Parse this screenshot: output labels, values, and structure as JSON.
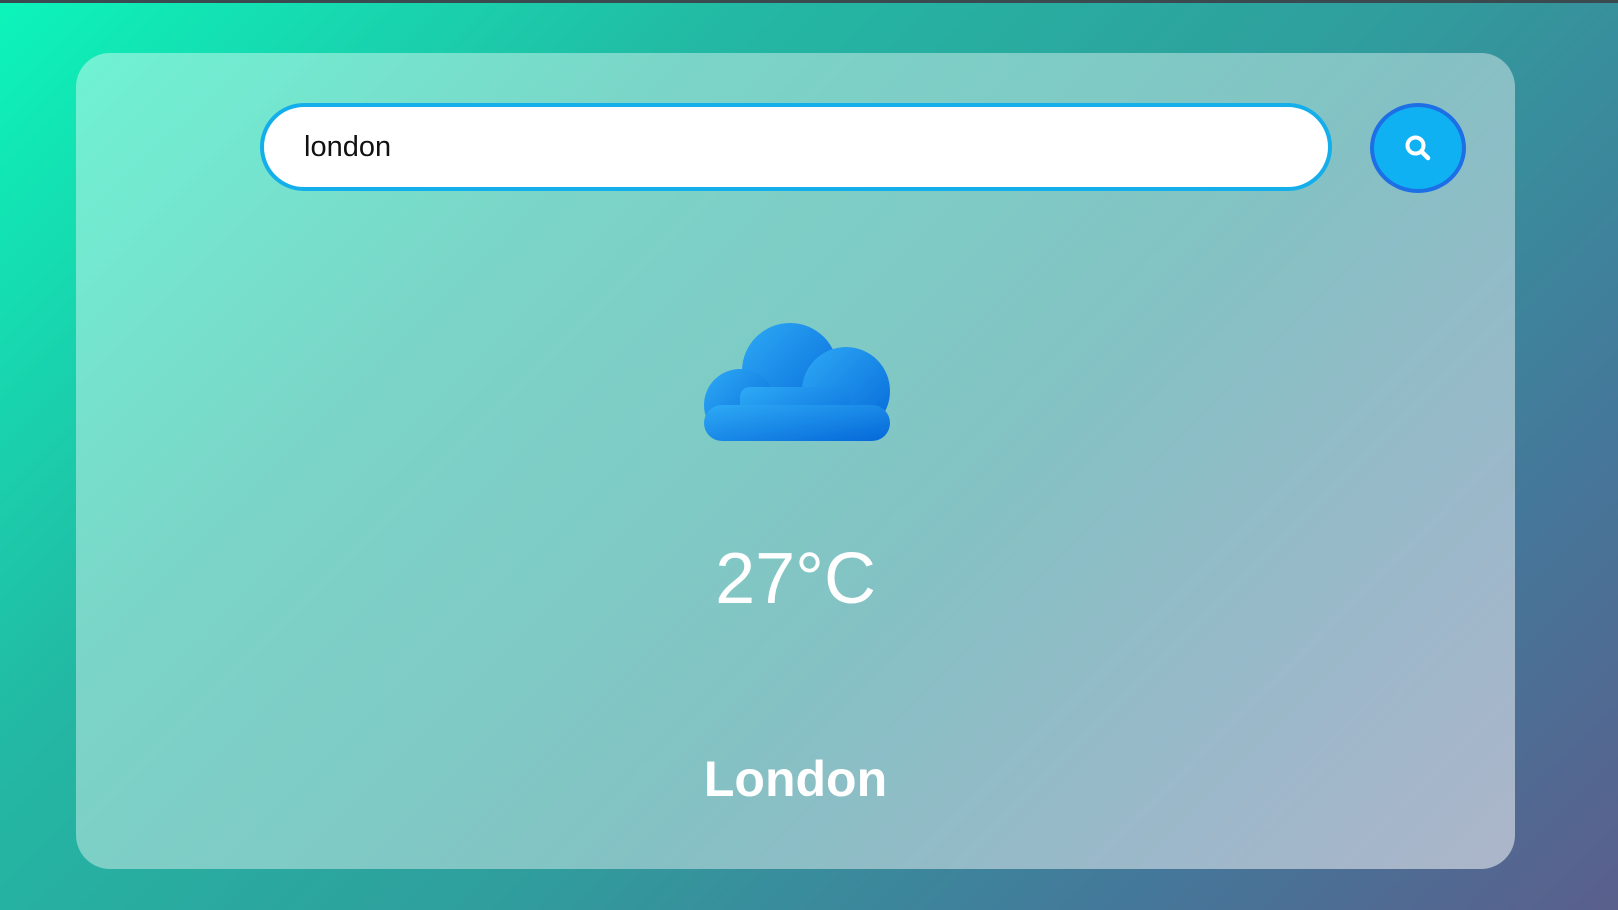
{
  "search": {
    "value": "london",
    "button_icon": "search-icon"
  },
  "weather": {
    "icon": "cloud-icon",
    "temperature": "27°C",
    "city": "London"
  },
  "colors": {
    "accent": "#0fb1f2",
    "input_border": "#14aeea",
    "cloud_top": "#2aa3f4",
    "cloud_bottom": "#0a72dd",
    "text": "#ffffff"
  }
}
